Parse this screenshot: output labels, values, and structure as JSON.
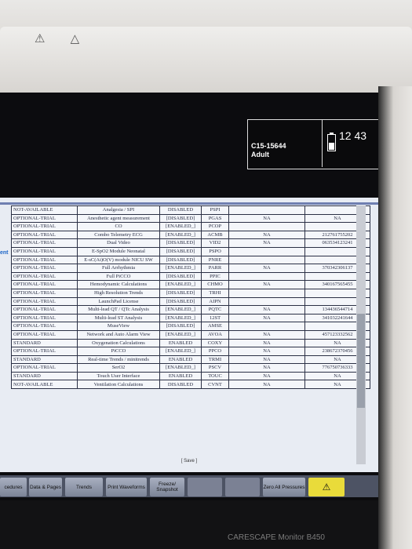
{
  "device": {
    "brand_label": "CARESCAPE Monitor B450",
    "bezel_icons": "⚠︎ △"
  },
  "status": {
    "patient_id": "C15-15644",
    "category": "Adult",
    "clock": "12 43"
  },
  "left_edge_label": "ent",
  "options": [
    {
      "status": "NOT-AVAILABLE",
      "function": "Analgesia / SPI",
      "state": "DISABLED",
      "code": "PSPI",
      "key1": "",
      "key2": ""
    },
    {
      "status": "OPTIONAL-TRIAL",
      "function": "Anesthetic agent measurement",
      "state": "[DISABLED]",
      "code": "PGAS",
      "key1": "NA",
      "key2": "NA"
    },
    {
      "status": "OPTIONAL-TRIAL",
      "function": "CO",
      "state": "[ENABLED_]",
      "code": "PCOP",
      "key1": "",
      "key2": ""
    },
    {
      "status": "OPTIONAL-TRIAL",
      "function": "Combo Telemetry ECG",
      "state": "[ENABLED_]",
      "code": "ACMB",
      "key1": "NA",
      "key2": "212761755202"
    },
    {
      "status": "OPTIONAL-TRIAL",
      "function": "Dual Video",
      "state": "[DISABLED]",
      "code": "VID2",
      "key1": "NA",
      "key2": "063534123241"
    },
    {
      "status": "OPTIONAL-TRIAL",
      "function": "E-SpO2 Module Neonatal",
      "state": "[DISABLED]",
      "code": "PSPO",
      "key1": "",
      "key2": ""
    },
    {
      "status": "OPTIONAL-TRIAL",
      "function": "E-sC(Ai)O(V) module NICU SW",
      "state": "[DISABLED]",
      "code": "PNRE",
      "key1": "",
      "key2": ""
    },
    {
      "status": "OPTIONAL-TRIAL",
      "function": "Full Arrhythmia",
      "state": "[ENABLED_]",
      "code": "PARR",
      "key1": "NA",
      "key2": "370342306137"
    },
    {
      "status": "OPTIONAL-TRIAL",
      "function": "Full PiCCO",
      "state": "[DISABLED]",
      "code": "PPIC",
      "key1": "",
      "key2": ""
    },
    {
      "status": "OPTIONAL-TRIAL",
      "function": "Hemodynamic Calculations",
      "state": "[ENABLED_]",
      "code": "CHMO",
      "key1": "NA",
      "key2": "340167565455"
    },
    {
      "status": "OPTIONAL-TRIAL",
      "function": "High Resolution Trends",
      "state": "[DISABLED]",
      "code": "TRHI",
      "key1": "",
      "key2": ""
    },
    {
      "status": "OPTIONAL-TRIAL",
      "function": "LaunchPad License",
      "state": "[DISABLED]",
      "code": "AIPN",
      "key1": "",
      "key2": ""
    },
    {
      "status": "OPTIONAL-TRIAL",
      "function": "Multi-lead QT / QTc Analysis",
      "state": "[ENABLED_]",
      "code": "PQTC",
      "key1": "NA",
      "key2": "134436544714"
    },
    {
      "status": "OPTIONAL-TRIAL",
      "function": "Multi-lead ST Analysis",
      "state": "[ENABLED_]",
      "code": "12ST",
      "key1": "NA",
      "key2": "341032241644"
    },
    {
      "status": "OPTIONAL-TRIAL",
      "function": "MuseView",
      "state": "[DISABLED]",
      "code": "AMSE",
      "key1": "",
      "key2": ""
    },
    {
      "status": "OPTIONAL-TRIAL",
      "function": "Network and Auto Alarm View",
      "state": "[ENABLED_]",
      "code": "AVOA",
      "key1": "NA",
      "key2": "457123332562"
    },
    {
      "status": "STANDARD",
      "function": "Oxygenation Calculations",
      "state": "ENABLED",
      "code": "COXY",
      "key1": "NA",
      "key2": "NA"
    },
    {
      "status": "OPTIONAL-TRIAL",
      "function": "PiCCO",
      "state": "[ENABLED_]",
      "code": "PPCO",
      "key1": "NA",
      "key2": "238672370456"
    },
    {
      "status": "STANDARD",
      "function": "Real-time Trends / minitrends",
      "state": "ENABLED",
      "code": "TRMI",
      "key1": "NA",
      "key2": "NA"
    },
    {
      "status": "OPTIONAL-TRIAL",
      "function": "SerO2",
      "state": "[ENABLED_]",
      "code": "PSCV",
      "key1": "NA",
      "key2": "776750736333"
    },
    {
      "status": "STANDARD",
      "function": "Touch User Interface",
      "state": "ENABLED",
      "code": "TOUC",
      "key1": "NA",
      "key2": "NA"
    },
    {
      "status": "NOT-AVAILABLE",
      "function": "Ventilation Calculations",
      "state": "DISABLED",
      "code": "CVNT",
      "key1": "NA",
      "key2": "NA"
    }
  ],
  "save_label": "[ Save ]",
  "buttons": [
    "cedures",
    "Data & Pages",
    "Trends",
    "Print Waveforms",
    "Freeze/ Snapshot",
    "",
    "",
    "Zero All Pressures"
  ],
  "alarm_glyph": "⚠︎"
}
